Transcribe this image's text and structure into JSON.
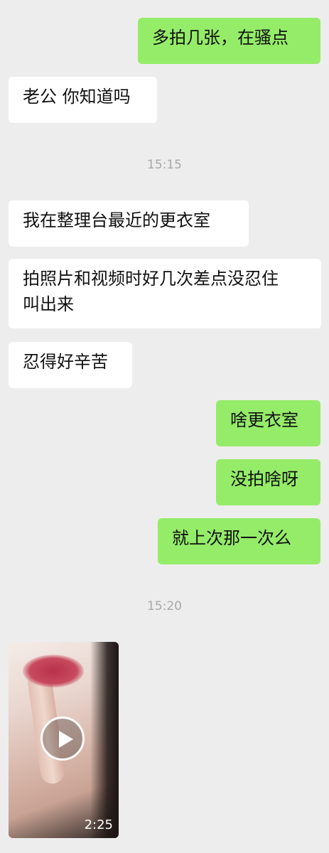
{
  "messages": [
    {
      "text": "多拍几张，在骚点"
    },
    {
      "text": "老公 你知道吗"
    },
    {
      "text": "我在整理台最近的更衣室"
    },
    {
      "text": "拍照片和视频时好几次差点没忍住\n叫出来"
    },
    {
      "text": "忍得好辛苦"
    },
    {
      "text": "啥更衣室"
    },
    {
      "text": "没拍啥呀"
    },
    {
      "text": "就上次那一次么"
    }
  ],
  "timestamps": [
    "15:15",
    "15:20"
  ],
  "video": {
    "duration": "2:25",
    "icon": "play-icon"
  },
  "colors": {
    "outgoing": "#95ec69",
    "incoming": "#ffffff",
    "background": "#ededed"
  }
}
